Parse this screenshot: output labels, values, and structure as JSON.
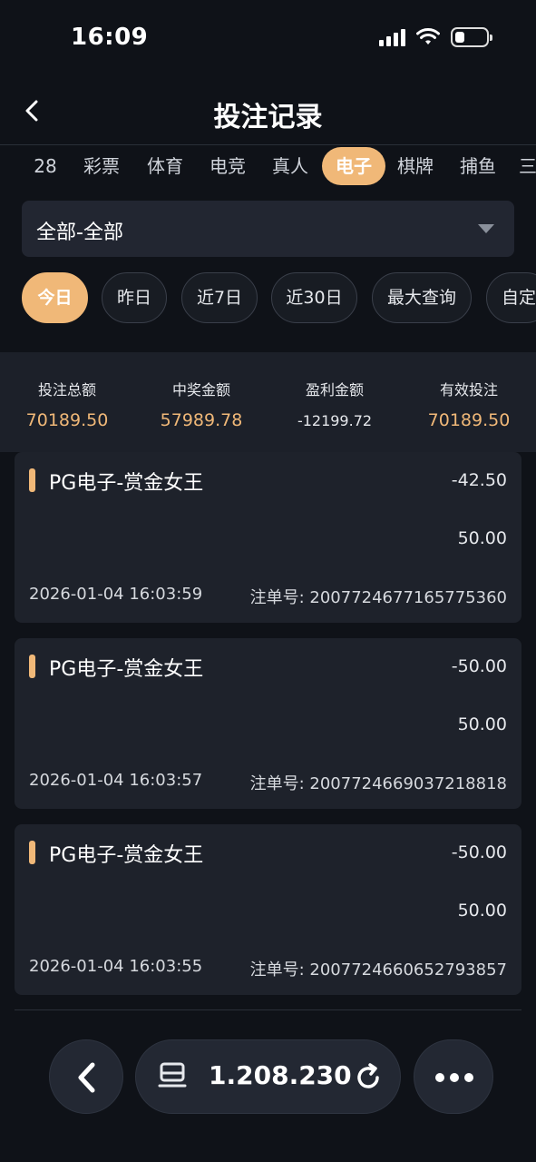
{
  "status_bar": {
    "time": "16:09",
    "battery_level": 0.3
  },
  "header": {
    "title": "投注记录"
  },
  "tabs": [
    {
      "label": "28"
    },
    {
      "label": "彩票"
    },
    {
      "label": "体育"
    },
    {
      "label": "电竞"
    },
    {
      "label": "真人"
    },
    {
      "label": "电子",
      "active": true
    },
    {
      "label": "棋牌"
    },
    {
      "label": "捕鱼"
    },
    {
      "label": "三"
    }
  ],
  "filter": {
    "selected": "全部-全部"
  },
  "date_ranges": [
    {
      "label": "今日",
      "active": true
    },
    {
      "label": "昨日"
    },
    {
      "label": "近7日"
    },
    {
      "label": "近30日"
    },
    {
      "label": "最大查询"
    },
    {
      "label": "自定"
    }
  ],
  "summary": {
    "total_bet_label": "投注总额",
    "total_bet": "70189.50",
    "win_label": "中奖金额",
    "win": "57989.78",
    "profit_label": "盈利金额",
    "profit": "-12199.72",
    "valid_bet_label": "有效投注",
    "valid_bet": "70189.50"
  },
  "records": [
    {
      "game": "PG电子-赏金女王",
      "win_loss": "-42.50",
      "bet": "50.00",
      "time": "2026-01-04 16:03:59",
      "order": "注单号: 2007724677165775360"
    },
    {
      "game": "PG电子-赏金女王",
      "win_loss": "-50.00",
      "bet": "50.00",
      "time": "2026-01-04 16:03:57",
      "order": "注单号: 2007724669037218818"
    },
    {
      "game": "PG电子-赏金女王",
      "win_loss": "-50.00",
      "bet": "50.00",
      "time": "2026-01-04 16:03:55",
      "order": "注单号: 2007724660652793857"
    }
  ],
  "bottom_bar": {
    "balance": "1.208.230"
  },
  "colors": {
    "accent": "#f0b878",
    "background": "#0f1218",
    "card": "#1e222b"
  }
}
